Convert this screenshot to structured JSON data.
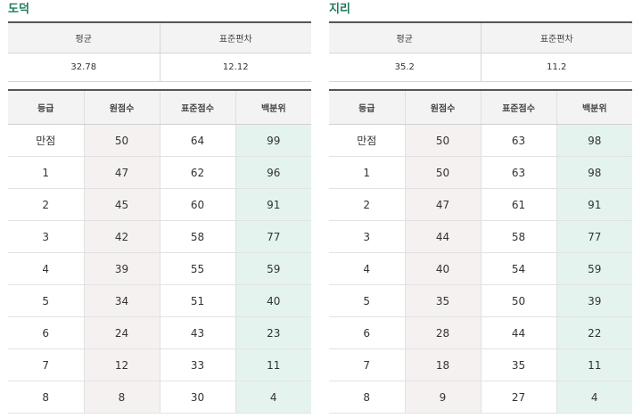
{
  "panels": [
    {
      "title": "도덕",
      "summary": {
        "headers": [
          "평균",
          "표준편차"
        ],
        "values": [
          "32.78",
          "12.12"
        ]
      },
      "grades": {
        "headers": [
          "등급",
          "원점수",
          "표준점수",
          "백분위"
        ],
        "rows": [
          [
            "만점",
            "50",
            "64",
            "99"
          ],
          [
            "1",
            "47",
            "62",
            "96"
          ],
          [
            "2",
            "45",
            "60",
            "91"
          ],
          [
            "3",
            "42",
            "58",
            "77"
          ],
          [
            "4",
            "39",
            "55",
            "59"
          ],
          [
            "5",
            "34",
            "51",
            "40"
          ],
          [
            "6",
            "24",
            "43",
            "23"
          ],
          [
            "7",
            "12",
            "33",
            "11"
          ],
          [
            "8",
            "8",
            "30",
            "4"
          ]
        ]
      }
    },
    {
      "title": "지리",
      "summary": {
        "headers": [
          "평균",
          "표준편차"
        ],
        "values": [
          "35.2",
          "11.2"
        ]
      },
      "grades": {
        "headers": [
          "등급",
          "원점수",
          "표준점수",
          "백분위"
        ],
        "rows": [
          [
            "만점",
            "50",
            "63",
            "98"
          ],
          [
            "1",
            "50",
            "63",
            "98"
          ],
          [
            "2",
            "47",
            "61",
            "91"
          ],
          [
            "3",
            "44",
            "58",
            "77"
          ],
          [
            "4",
            "40",
            "54",
            "59"
          ],
          [
            "5",
            "35",
            "50",
            "39"
          ],
          [
            "6",
            "28",
            "44",
            "22"
          ],
          [
            "7",
            "18",
            "35",
            "11"
          ],
          [
            "8",
            "9",
            "27",
            "4"
          ]
        ]
      }
    }
  ]
}
